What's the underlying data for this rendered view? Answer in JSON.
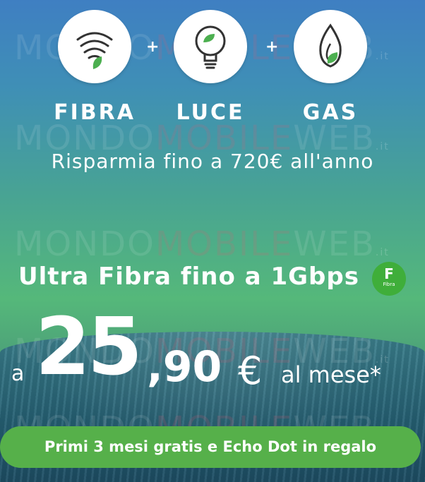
{
  "services": [
    {
      "label": "FIBRA",
      "icon": "wifi-leaf-icon"
    },
    {
      "label": "LUCE",
      "icon": "lightbulb-leaf-icon"
    },
    {
      "label": "GAS",
      "icon": "flame-leaf-icon"
    }
  ],
  "plus_symbol": "+",
  "savings_text": "Risparmia fino a 720€ all'anno",
  "watermark": {
    "part1": "MONDO",
    "part2": "MOBILE",
    "part3": "WEB",
    "suffix": ".it"
  },
  "offer": {
    "title": "Ultra Fibra fino a 1Gbps",
    "badge_letter": "F",
    "badge_sub": "Fibra",
    "price_prefix": "a",
    "price_euros": "25",
    "price_cents": ",90",
    "currency": "€",
    "price_suffix": "al mese*"
  },
  "promo_label": "Primi 3 mesi gratis e Echo Dot in regalo",
  "colors": {
    "accent_green": "#56b04a",
    "badge_green": "#3fae3a",
    "leaf_green": "#4caf50"
  }
}
